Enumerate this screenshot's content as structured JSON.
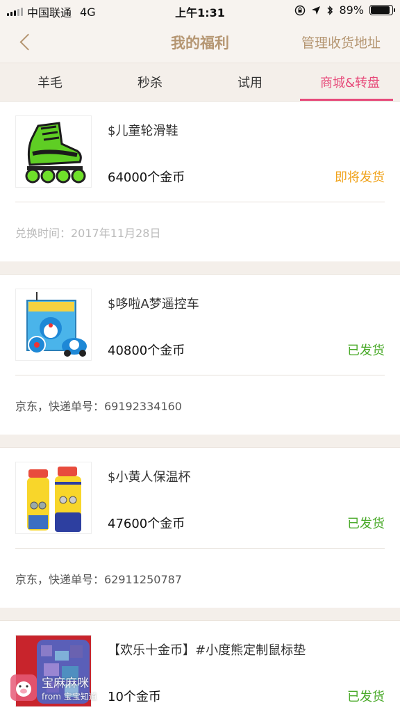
{
  "status_bar": {
    "carrier": "中国联通",
    "network": "4G",
    "time": "上午1:31",
    "battery": "89%",
    "battery_level": 0.89
  },
  "nav": {
    "title": "我的福利",
    "right_action": "管理收货地址",
    "back_icon": "chevron-left-icon"
  },
  "tabs": [
    {
      "label": "羊毛",
      "active": false
    },
    {
      "label": "秒杀",
      "active": false
    },
    {
      "label": "试用",
      "active": false
    },
    {
      "label": "商城&转盘",
      "active": true
    }
  ],
  "orders": [
    {
      "name": "$儿童轮滑鞋",
      "price": "64000个金币",
      "status": "即将发货",
      "footer": "兑换时间：2017年11月28日",
      "image": "roller-skate"
    },
    {
      "name": "$哆啦A梦遥控车",
      "price": "40800个金币",
      "status": "已发货",
      "footer": "京东，快递单号：69192334160",
      "image": "doraemon-rc-car"
    },
    {
      "name": "$小黄人保温杯",
      "price": "47600个金币",
      "status": "已发货",
      "footer": "京东，快递单号：62911250787",
      "image": "minion-thermos"
    },
    {
      "name": "【欢乐十金币】#小度熊定制鼠标垫",
      "price": "10个金币",
      "status": "已发货",
      "footer": "",
      "image": "bear-mousepad"
    }
  ],
  "watermark": {
    "line1": "宝麻麻咪",
    "line2": "from 宝宝知道"
  },
  "colors": {
    "accent": "#e74a7a",
    "nav_text": "#b59672",
    "pending": "#f0a31b",
    "shipped": "#4aaa2a",
    "background": "#f4efea"
  }
}
